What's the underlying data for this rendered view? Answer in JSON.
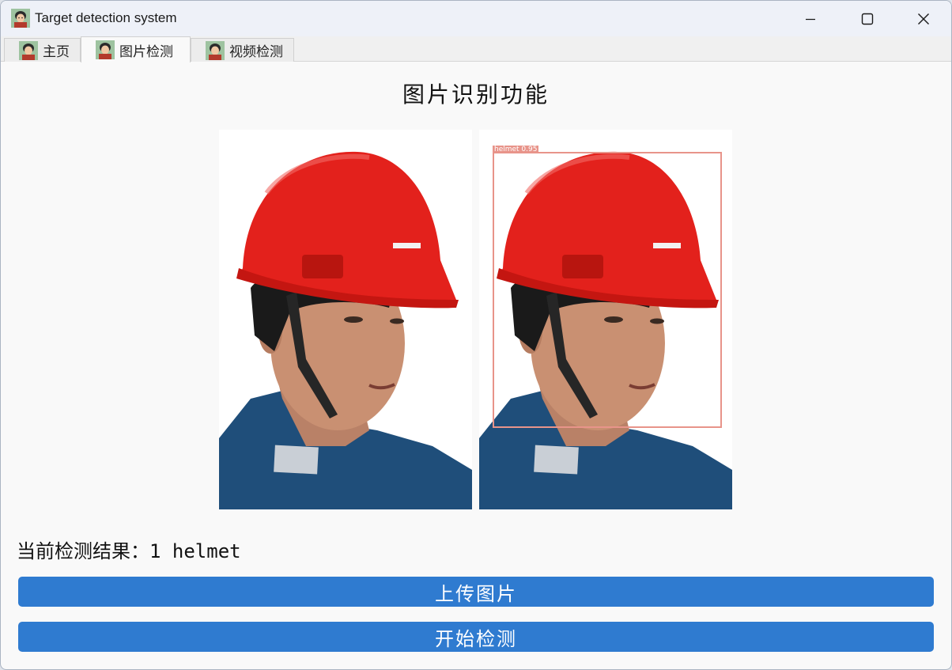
{
  "window": {
    "title": "Target detection system",
    "icon": "avatar-icon"
  },
  "tabs": [
    {
      "label": "主页",
      "icon": "avatar-icon",
      "active": false
    },
    {
      "label": "图片检测",
      "icon": "avatar-icon",
      "active": true
    },
    {
      "label": "视频检测",
      "icon": "avatar-icon",
      "active": false
    }
  ],
  "main": {
    "title": "图片识别功能",
    "detection": {
      "label": "helmet",
      "confidence": "0.95",
      "tag": "helmet  0.95"
    },
    "result_text": "当前检测结果：1 helmet",
    "upload_button": "上传图片",
    "detect_button": "开始检测"
  },
  "colors": {
    "accent": "#2f7bd0",
    "detection_box": "#e8948a",
    "helmet": "#e3211c"
  }
}
